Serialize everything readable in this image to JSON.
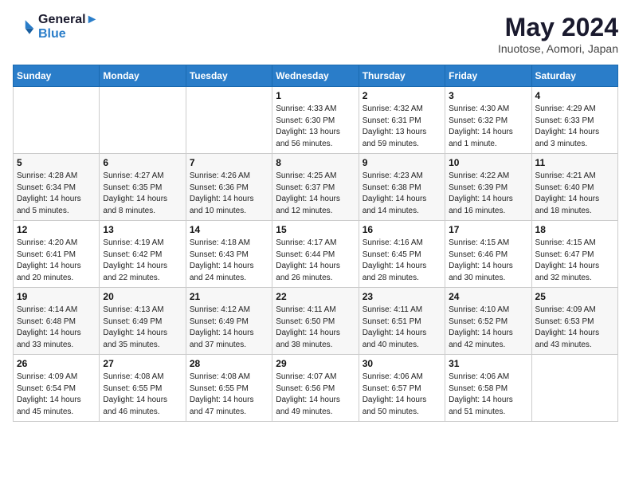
{
  "header": {
    "logo_line1": "General",
    "logo_line2": "Blue",
    "month": "May 2024",
    "location": "Inuotose, Aomori, Japan"
  },
  "weekdays": [
    "Sunday",
    "Monday",
    "Tuesday",
    "Wednesday",
    "Thursday",
    "Friday",
    "Saturday"
  ],
  "weeks": [
    [
      null,
      null,
      null,
      {
        "day": "1",
        "rise": "4:33 AM",
        "set": "6:30 PM",
        "daylight": "13 hours and 56 minutes."
      },
      {
        "day": "2",
        "rise": "4:32 AM",
        "set": "6:31 PM",
        "daylight": "13 hours and 59 minutes."
      },
      {
        "day": "3",
        "rise": "4:30 AM",
        "set": "6:32 PM",
        "daylight": "14 hours and 1 minute."
      },
      {
        "day": "4",
        "rise": "4:29 AM",
        "set": "6:33 PM",
        "daylight": "14 hours and 3 minutes."
      }
    ],
    [
      {
        "day": "5",
        "rise": "4:28 AM",
        "set": "6:34 PM",
        "daylight": "14 hours and 5 minutes."
      },
      {
        "day": "6",
        "rise": "4:27 AM",
        "set": "6:35 PM",
        "daylight": "14 hours and 8 minutes."
      },
      {
        "day": "7",
        "rise": "4:26 AM",
        "set": "6:36 PM",
        "daylight": "14 hours and 10 minutes."
      },
      {
        "day": "8",
        "rise": "4:25 AM",
        "set": "6:37 PM",
        "daylight": "14 hours and 12 minutes."
      },
      {
        "day": "9",
        "rise": "4:23 AM",
        "set": "6:38 PM",
        "daylight": "14 hours and 14 minutes."
      },
      {
        "day": "10",
        "rise": "4:22 AM",
        "set": "6:39 PM",
        "daylight": "14 hours and 16 minutes."
      },
      {
        "day": "11",
        "rise": "4:21 AM",
        "set": "6:40 PM",
        "daylight": "14 hours and 18 minutes."
      }
    ],
    [
      {
        "day": "12",
        "rise": "4:20 AM",
        "set": "6:41 PM",
        "daylight": "14 hours and 20 minutes."
      },
      {
        "day": "13",
        "rise": "4:19 AM",
        "set": "6:42 PM",
        "daylight": "14 hours and 22 minutes."
      },
      {
        "day": "14",
        "rise": "4:18 AM",
        "set": "6:43 PM",
        "daylight": "14 hours and 24 minutes."
      },
      {
        "day": "15",
        "rise": "4:17 AM",
        "set": "6:44 PM",
        "daylight": "14 hours and 26 minutes."
      },
      {
        "day": "16",
        "rise": "4:16 AM",
        "set": "6:45 PM",
        "daylight": "14 hours and 28 minutes."
      },
      {
        "day": "17",
        "rise": "4:15 AM",
        "set": "6:46 PM",
        "daylight": "14 hours and 30 minutes."
      },
      {
        "day": "18",
        "rise": "4:15 AM",
        "set": "6:47 PM",
        "daylight": "14 hours and 32 minutes."
      }
    ],
    [
      {
        "day": "19",
        "rise": "4:14 AM",
        "set": "6:48 PM",
        "daylight": "14 hours and 33 minutes."
      },
      {
        "day": "20",
        "rise": "4:13 AM",
        "set": "6:49 PM",
        "daylight": "14 hours and 35 minutes."
      },
      {
        "day": "21",
        "rise": "4:12 AM",
        "set": "6:49 PM",
        "daylight": "14 hours and 37 minutes."
      },
      {
        "day": "22",
        "rise": "4:11 AM",
        "set": "6:50 PM",
        "daylight": "14 hours and 38 minutes."
      },
      {
        "day": "23",
        "rise": "4:11 AM",
        "set": "6:51 PM",
        "daylight": "14 hours and 40 minutes."
      },
      {
        "day": "24",
        "rise": "4:10 AM",
        "set": "6:52 PM",
        "daylight": "14 hours and 42 minutes."
      },
      {
        "day": "25",
        "rise": "4:09 AM",
        "set": "6:53 PM",
        "daylight": "14 hours and 43 minutes."
      }
    ],
    [
      {
        "day": "26",
        "rise": "4:09 AM",
        "set": "6:54 PM",
        "daylight": "14 hours and 45 minutes."
      },
      {
        "day": "27",
        "rise": "4:08 AM",
        "set": "6:55 PM",
        "daylight": "14 hours and 46 minutes."
      },
      {
        "day": "28",
        "rise": "4:08 AM",
        "set": "6:55 PM",
        "daylight": "14 hours and 47 minutes."
      },
      {
        "day": "29",
        "rise": "4:07 AM",
        "set": "6:56 PM",
        "daylight": "14 hours and 49 minutes."
      },
      {
        "day": "30",
        "rise": "4:06 AM",
        "set": "6:57 PM",
        "daylight": "14 hours and 50 minutes."
      },
      {
        "day": "31",
        "rise": "4:06 AM",
        "set": "6:58 PM",
        "daylight": "14 hours and 51 minutes."
      },
      null
    ]
  ],
  "labels": {
    "sunrise": "Sunrise:",
    "sunset": "Sunset:",
    "daylight": "Daylight:"
  }
}
